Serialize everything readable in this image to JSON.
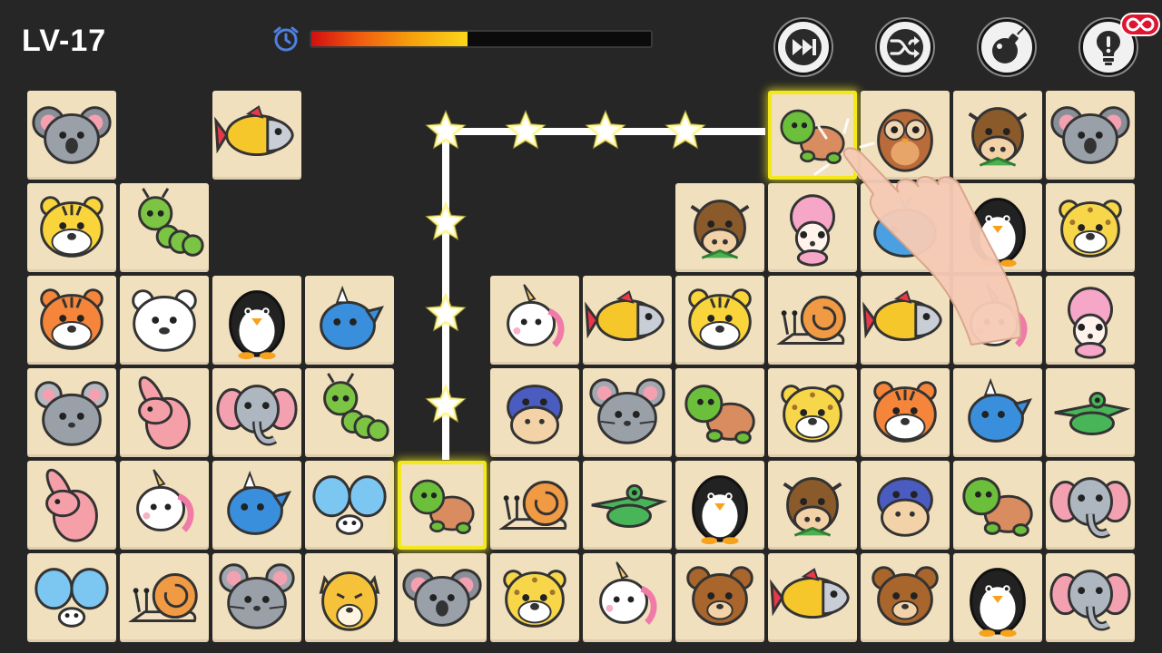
{
  "level_label": "LV-17",
  "timer": {
    "remaining_fraction": 0.46,
    "icon": "alarm-clock-icon"
  },
  "tools": [
    {
      "name": "skip-button",
      "icon": "skip-forward-icon"
    },
    {
      "name": "shuffle-button",
      "icon": "shuffle-icon"
    },
    {
      "name": "bomb-button",
      "icon": "bomb-icon"
    },
    {
      "name": "hint-button",
      "icon": "lightbulb-icon",
      "badge": "infinity-badge"
    }
  ],
  "colors": {
    "background": "#262626",
    "tile": "#f1e0be",
    "selection": "#f2e81c",
    "path": "#ffffff",
    "badge": "#e01430"
  },
  "board": {
    "rows": 6,
    "cols": 12,
    "grid": [
      [
        "koala",
        null,
        "fish",
        null,
        null,
        null,
        null,
        null,
        "turtle",
        "owl",
        "cow",
        "koala"
      ],
      [
        "tiger",
        "caterpillar",
        null,
        null,
        null,
        null,
        null,
        "cow",
        "poodle",
        "whale",
        "penguin",
        "leopard"
      ],
      [
        "tiger-orange",
        "polar-bear",
        "penguin",
        "dino",
        null,
        "unicorn",
        "fish",
        "tiger",
        "snail",
        "fish",
        "unicorn",
        "poodle"
      ],
      [
        "hamster",
        "rabbit",
        "elephant",
        "caterpillar",
        null,
        "hippo",
        "mouse",
        "turtle",
        "leopard",
        "tiger-orange",
        "dino",
        "crocodile"
      ],
      [
        "rabbit",
        "unicorn",
        "dino",
        "butterfly",
        "turtle",
        "snail",
        "crocodile",
        "penguin",
        "cow",
        "hippo",
        "turtle",
        "elephant"
      ],
      [
        "butterfly",
        "snail",
        "mouse",
        "cheetah",
        "koala",
        "leopard",
        "unicorn",
        "bear",
        "fish",
        "bear",
        "penguin",
        "elephant"
      ]
    ],
    "selected": [
      [
        0,
        8
      ],
      [
        4,
        4
      ]
    ],
    "connection_path": {
      "cells": [
        [
          0,
          8
        ],
        [
          0,
          4
        ],
        [
          4,
          4
        ]
      ],
      "star_count": 7
    },
    "hint_hand": "pointing-hand-icon"
  }
}
